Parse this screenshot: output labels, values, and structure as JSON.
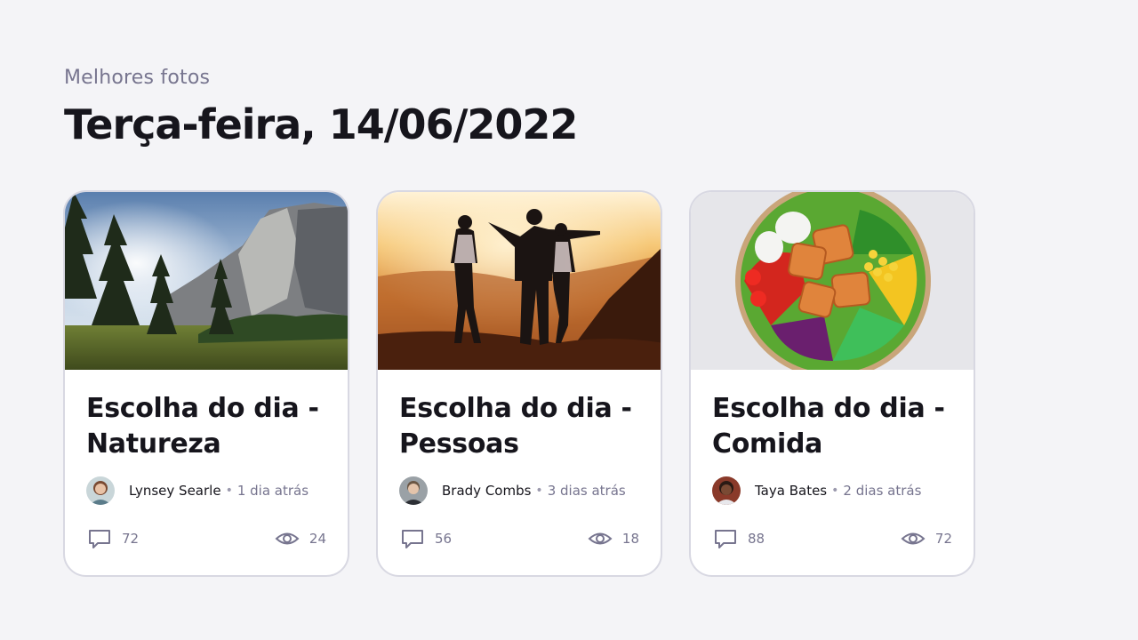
{
  "header": {
    "eyebrow": "Melhores fotos",
    "title": "Terça-feira, 14/06/2022"
  },
  "cards": [
    {
      "title": "Escolha do dia - Natureza",
      "image": "mountain-forest-photo",
      "author": "Lynsey Searle",
      "separator": "•",
      "time": "1 dia atrás",
      "comments": "72",
      "views": "24"
    },
    {
      "title": "Escolha do dia - Pessoas",
      "image": "people-sunset-photo",
      "author": "Brady Combs",
      "separator": "•",
      "time": "3 dias atrás",
      "comments": "56",
      "views": "18"
    },
    {
      "title": "Escolha do dia - Comida",
      "image": "salad-bowl-photo",
      "author": "Taya Bates",
      "separator": "•",
      "time": "2 dias atrás",
      "comments": "88",
      "views": "72"
    }
  ],
  "colors": {
    "background": "#f4f4f7",
    "text_primary": "#16151c",
    "text_secondary": "#77758f",
    "card_border": "#d8d8e2"
  },
  "icons": {
    "comments": "comment-icon",
    "views": "eye-icon"
  }
}
